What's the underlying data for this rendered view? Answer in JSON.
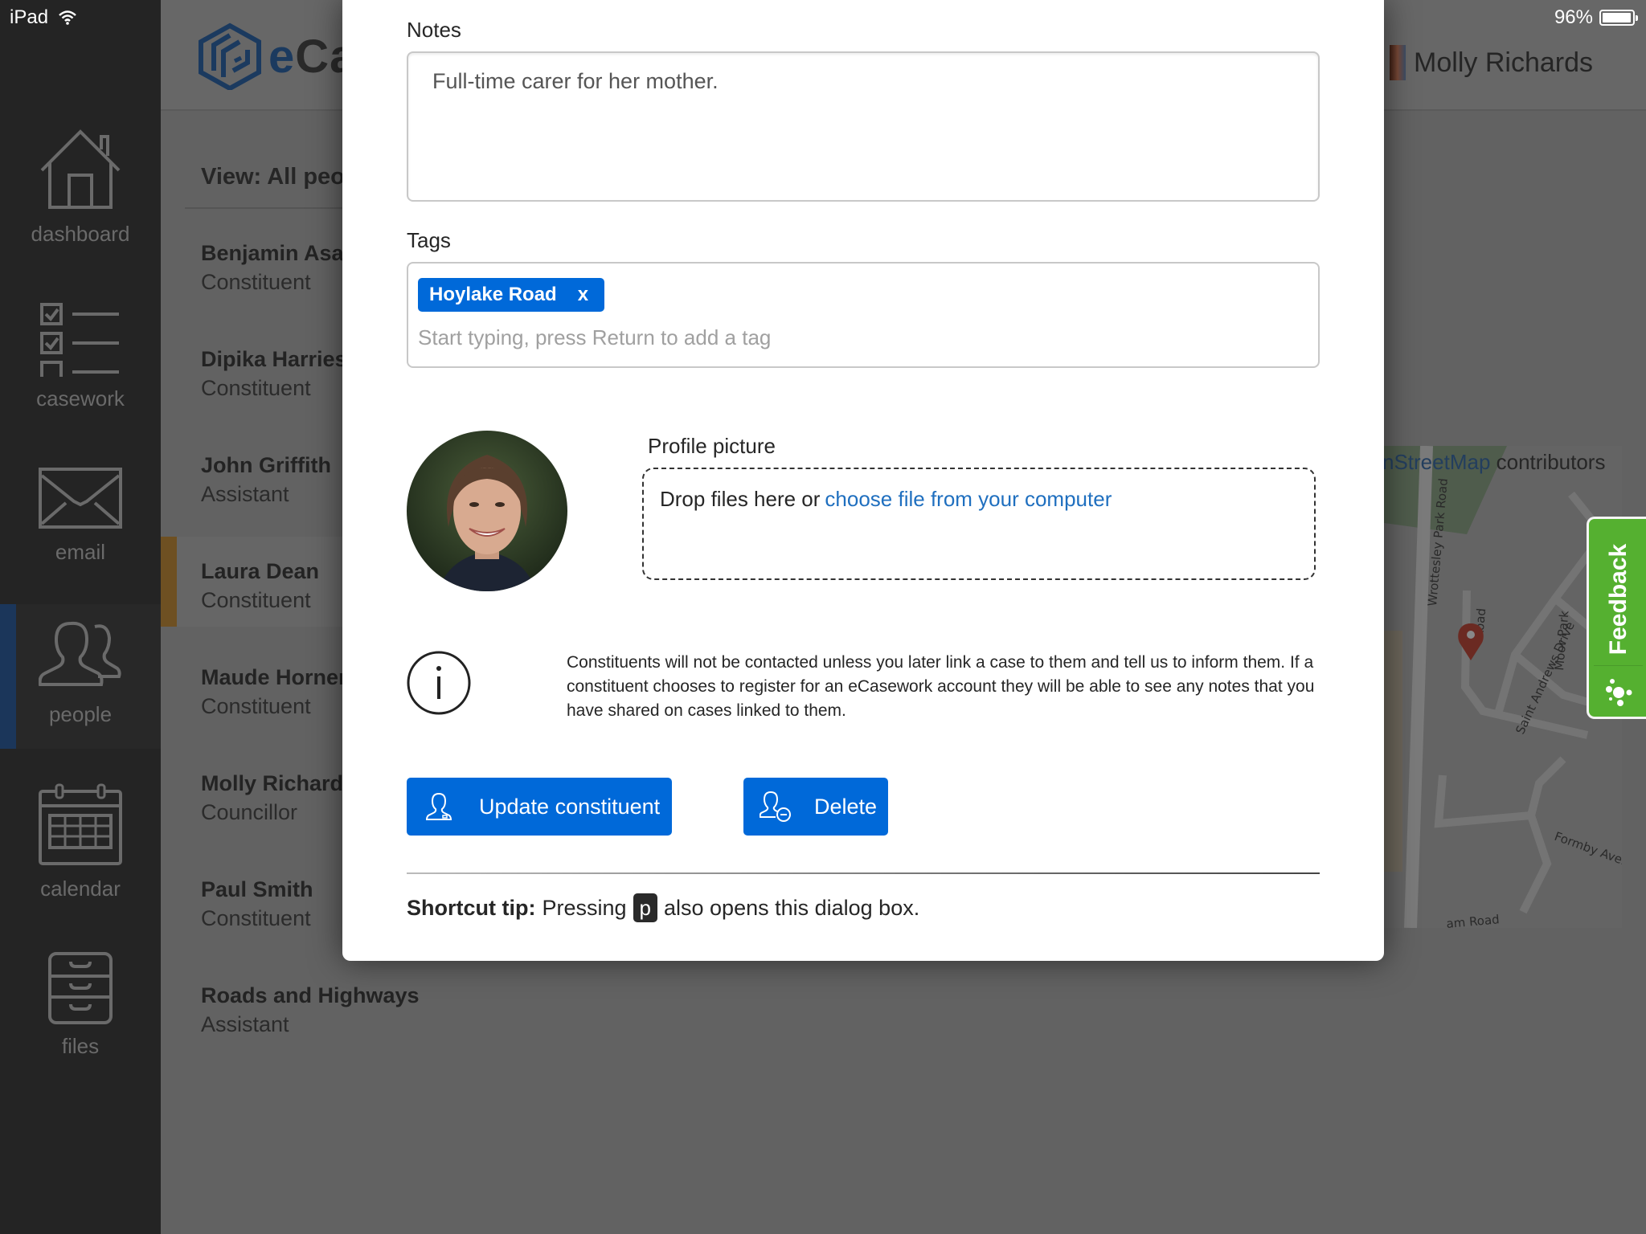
{
  "status_bar": {
    "device": "iPad",
    "battery_percent": "96%",
    "battery_level": 0.96
  },
  "app": {
    "logo_text_part1": "e",
    "logo_text_part2": "Ca"
  },
  "sidebar": {
    "items": [
      {
        "label": "dashboard",
        "icon": "house-icon",
        "active": false
      },
      {
        "label": "casework",
        "icon": "checklist-icon",
        "active": false
      },
      {
        "label": "email",
        "icon": "envelope-icon",
        "active": false
      },
      {
        "label": "people",
        "icon": "people-icon",
        "active": true
      },
      {
        "label": "calendar",
        "icon": "calendar-icon",
        "active": false
      },
      {
        "label": "files",
        "icon": "file-cabinet-icon",
        "active": false
      }
    ]
  },
  "header": {
    "user_name": "Molly Richards"
  },
  "list": {
    "view_title": "View: All peo",
    "people": [
      {
        "name": "Benjamin Asar",
        "role": "Constituent"
      },
      {
        "name": "Dipika Harries",
        "role": "Constituent"
      },
      {
        "name": "John Griffith",
        "role": "Assistant"
      },
      {
        "name": "Laura Dean",
        "role": "Constituent",
        "selected": true
      },
      {
        "name": "Maude Horner",
        "role": "Constituent"
      },
      {
        "name": "Molly Richards",
        "role": "Councillor"
      },
      {
        "name": "Paul Smith",
        "role": "Constituent"
      },
      {
        "name": "Roads and Highways",
        "role": "Assistant"
      }
    ]
  },
  "map": {
    "attribution_link": "nStreetMap",
    "attribution_text": " contributors",
    "street_labels": [
      "Wrottesley Park Road",
      "Saint Andrews Drive",
      "Road",
      "Moor Park",
      "Formby Avenue",
      "am Road"
    ]
  },
  "feedback": {
    "label": "Feedback"
  },
  "modal": {
    "notes_label": "Notes",
    "notes_value": "Full-time carer for her mother.",
    "tags_label": "Tags",
    "tags": [
      {
        "label": "Hoylake Road",
        "remove": "x"
      }
    ],
    "tags_placeholder": "Start typing, press Return to add a tag",
    "profile_picture_label": "Profile picture",
    "dropzone_text": "Drop files here or",
    "dropzone_link": "choose file from your computer",
    "info_text": "Constituents will not be contacted unless you later link a case to them and tell us to inform them. If a constituent chooses to register for an eCasework account they will be able to see any notes that you have shared on cases linked to them.",
    "update_button": "Update constituent",
    "delete_button": "Delete",
    "shortcut_label": "Shortcut tip:",
    "shortcut_pre": "Pressing",
    "shortcut_key": "p",
    "shortcut_post": "also opens this dialog box."
  },
  "colors": {
    "primary_blue": "#0069d9",
    "link_blue": "#1f6fbf",
    "feedback_green": "#55b030",
    "sidebar_bg": "#242424",
    "selected_marker": "#6e5022",
    "active_nav_marker": "#1b365a"
  }
}
